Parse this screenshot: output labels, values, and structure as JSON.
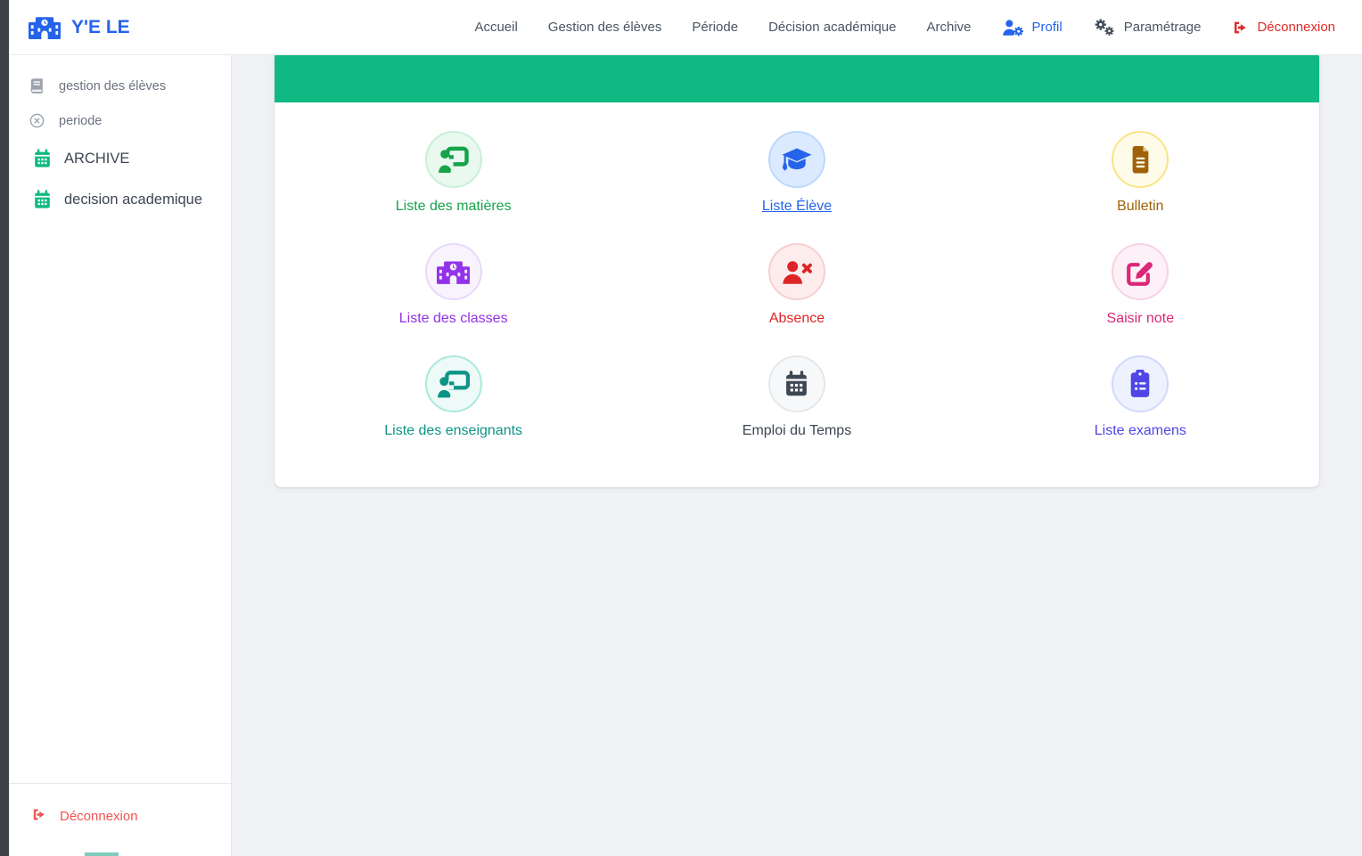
{
  "brand": {
    "name": "Y'E LE",
    "icon": "school-icon",
    "color": "#2563eb"
  },
  "navbar": {
    "items": [
      {
        "label": "Accueil"
      },
      {
        "label": "Gestion des élèves"
      },
      {
        "label": "Période"
      },
      {
        "label": "Décision académique"
      },
      {
        "label": "Archive"
      },
      {
        "label": "Profil",
        "icon": "user-gear-icon",
        "color": "#2563eb"
      },
      {
        "label": "Paramétrage",
        "icon": "gears-icon",
        "color": "#404a56"
      },
      {
        "label": "Déconnexion",
        "icon": "logout-icon",
        "color": "#e02a2a"
      }
    ]
  },
  "sidebar": {
    "items": [
      {
        "label": "gestion des élèves",
        "icon": "book-icon",
        "icon_color": "#9ca3af"
      },
      {
        "label": "periode",
        "icon": "circle-x-icon",
        "icon_color": "#9ca3af"
      },
      {
        "label": "ARCHIVE",
        "icon": "calendar-icon",
        "icon_color": "#10b981"
      },
      {
        "label": "decision academique",
        "icon": "calendar-icon",
        "icon_color": "#10b981"
      }
    ],
    "footer": {
      "label": "Déconnexion",
      "icon": "logout-icon",
      "color": "#ef5350"
    }
  },
  "main": {
    "header_color": "#10b981",
    "tiles": [
      {
        "label": "Liste des matières",
        "icon": "chalkboard-teacher-icon",
        "color": "#16a34a",
        "bg": "#e9f9ef",
        "border": "#c8f0d7"
      },
      {
        "label": "Liste Élève",
        "icon": "graduation-cap-icon",
        "color": "#2563eb",
        "bg": "#dbeafe",
        "border": "#bcd8fd",
        "underline": true
      },
      {
        "label": "Bulletin",
        "icon": "file-lines-icon",
        "color": "#a16207",
        "bg": "#fefce8",
        "border": "#fae388"
      },
      {
        "label": "Liste des classes",
        "icon": "school-icon",
        "color": "#9333ea",
        "bg": "#f8f3fd",
        "border": "#e9d8fa"
      },
      {
        "label": "Absence",
        "icon": "user-xmark-icon",
        "color": "#dc2626",
        "bg": "#fdecec",
        "border": "#f8cfcf"
      },
      {
        "label": "Saisir note",
        "icon": "pen-to-square-icon",
        "color": "#db2777",
        "bg": "#fdf1f7",
        "border": "#f8d1e5"
      },
      {
        "label": "Liste des enseignants",
        "icon": "teacher-screen-icon",
        "color": "#0d9488",
        "bg": "#edfaf7",
        "border": "#a9e9dd"
      },
      {
        "label": "Emploi du Temps",
        "icon": "calendar-days-icon",
        "color": "#3d4653",
        "bg": "#f7f8f9",
        "border": "#e5e8eb"
      },
      {
        "label": "Liste examens",
        "icon": "clipboard-list-icon",
        "color": "#4f46e5",
        "bg": "#eef1fe",
        "border": "#d1d9fc"
      }
    ]
  }
}
